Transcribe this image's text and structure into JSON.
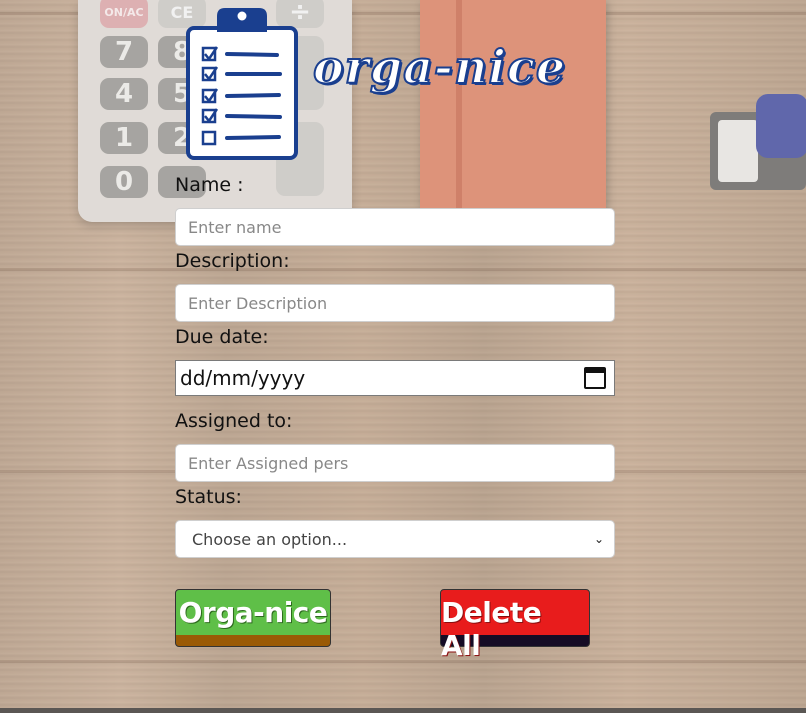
{
  "brand": {
    "name": "orga-nice"
  },
  "calculator": {
    "keys": [
      "ON/AC",
      "CE",
      "÷",
      "7",
      "8",
      "4",
      "5",
      "1",
      "2",
      "0",
      "."
    ]
  },
  "form": {
    "name": {
      "label": "Name :",
      "placeholder": "Enter name"
    },
    "description": {
      "label": "Description:",
      "placeholder": "Enter Description"
    },
    "due_date": {
      "label": "Due date:",
      "value": "dd/mm/yyyy"
    },
    "assigned_to": {
      "label": "Assigned to:",
      "placeholder": "Enter Assigned pers"
    },
    "status": {
      "label": "Status:",
      "selected": "Choose an option..."
    }
  },
  "buttons": {
    "submit": "Orga-nice",
    "delete_all": "Delete All"
  },
  "colors": {
    "brand_blue": "#1a3f8f",
    "submit_green": "#5fbf48",
    "delete_red": "#e81c1c"
  }
}
